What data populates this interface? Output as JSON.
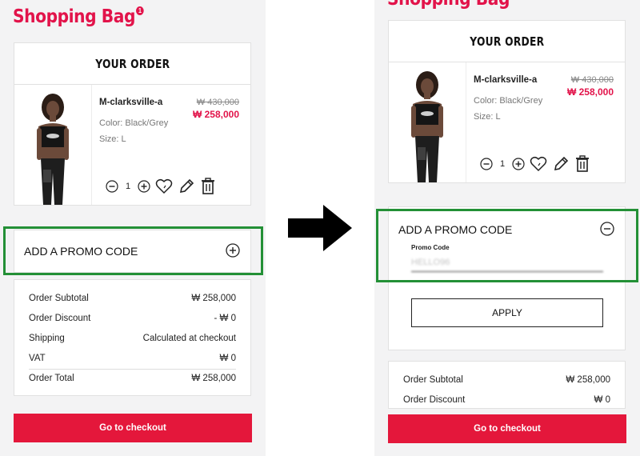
{
  "page": {
    "title": "Shopping Bag",
    "bag_count": "1"
  },
  "order": {
    "header": "YOUR ORDER",
    "item": {
      "name": "M-clarksville-a",
      "color": "Color:  Black/Grey",
      "size": "Size:  L",
      "price_old": "₩ 430,000",
      "price_new": "₩ 258,000",
      "quantity": "1"
    }
  },
  "promo": {
    "title": "ADD A PROMO CODE",
    "field_label": "Promo Code",
    "field_value": "HELLO96",
    "apply_label": "APPLY"
  },
  "summary": {
    "rows": [
      {
        "label": "Order Subtotal",
        "value": "₩ 258,000"
      },
      {
        "label": "Order Discount",
        "value": "- ₩ 0"
      },
      {
        "label": "Shipping",
        "value": "Calculated at checkout"
      },
      {
        "label": "VAT",
        "value": "₩ 0"
      },
      {
        "label": "Order Total",
        "value": "₩ 258,000"
      }
    ],
    "right_partial": [
      {
        "label": "Order Subtotal",
        "value": "₩ 258,000"
      },
      {
        "label": "Order Discount",
        "value": "₩ 0"
      }
    ]
  },
  "checkout_label": "Go to checkout",
  "colors": {
    "brand": "#e2134a",
    "checkout": "#e4173b",
    "highlight": "#239036"
  },
  "icons": [
    "minus-icon",
    "plus-icon",
    "heart-icon",
    "pencil-icon",
    "trash-icon",
    "plus-circle-icon",
    "minus-circle-icon",
    "arrow-right-icon"
  ]
}
